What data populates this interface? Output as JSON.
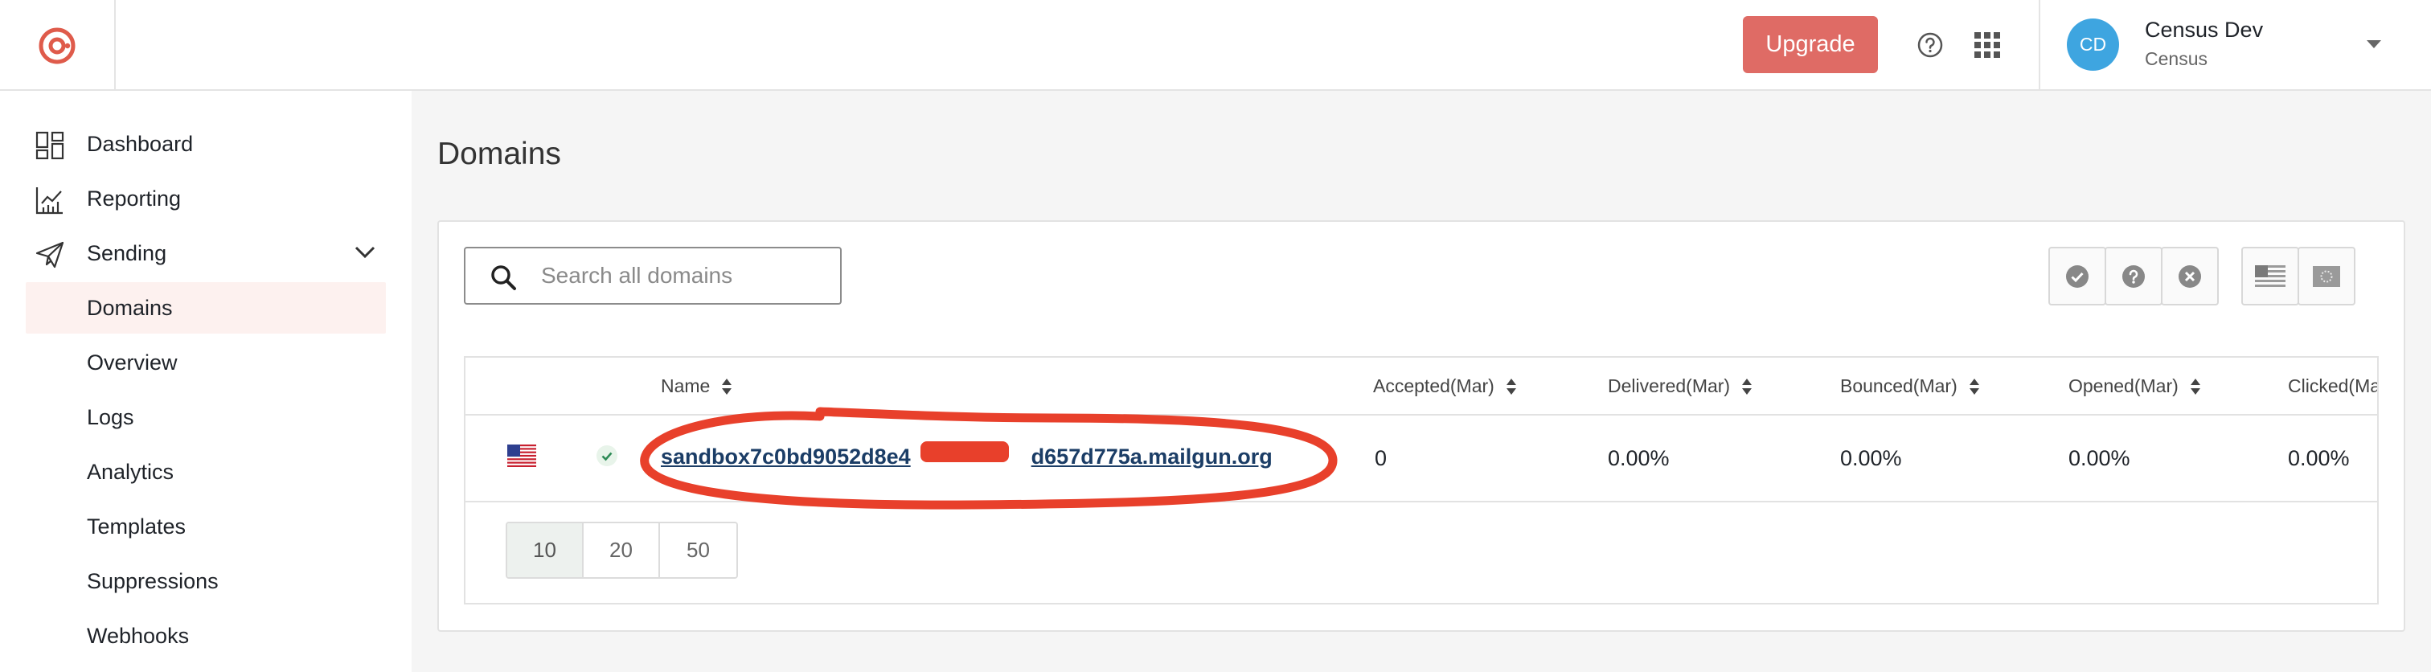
{
  "header": {
    "upgrade_label": "Upgrade",
    "user": {
      "initials": "CD",
      "name": "Census Dev",
      "org": "Census"
    },
    "accent_color": "#df6b65",
    "avatar_color": "#3ea5e0"
  },
  "sidebar": {
    "items": [
      {
        "label": "Dashboard",
        "icon": "dashboard-icon"
      },
      {
        "label": "Reporting",
        "icon": "chart-icon"
      },
      {
        "label": "Sending",
        "icon": "paper-plane-icon",
        "expanded": true
      },
      {
        "label": "Domains",
        "active": true
      },
      {
        "label": "Overview"
      },
      {
        "label": "Logs"
      },
      {
        "label": "Analytics"
      },
      {
        "label": "Templates"
      },
      {
        "label": "Suppressions"
      },
      {
        "label": "Webhooks"
      }
    ]
  },
  "main": {
    "title": "Domains",
    "search": {
      "placeholder": "Search all domains",
      "value": ""
    },
    "table": {
      "columns": [
        "Name",
        "Accepted(Mar)",
        "Delivered(Mar)",
        "Bounced(Mar)",
        "Opened(Mar)",
        "Clicked(Mar)"
      ],
      "rows": [
        {
          "domain_prefix": "sandbox7c0bd9052d8e4",
          "domain_suffix": "d657d775a.mailgun.org",
          "accepted": "0",
          "delivered": "0.00%",
          "bounced": "0.00%",
          "opened": "0.00%",
          "clicked": "0.00%"
        }
      ]
    },
    "page_sizes": [
      "10",
      "20",
      "50"
    ],
    "selected_page_size": "10"
  }
}
